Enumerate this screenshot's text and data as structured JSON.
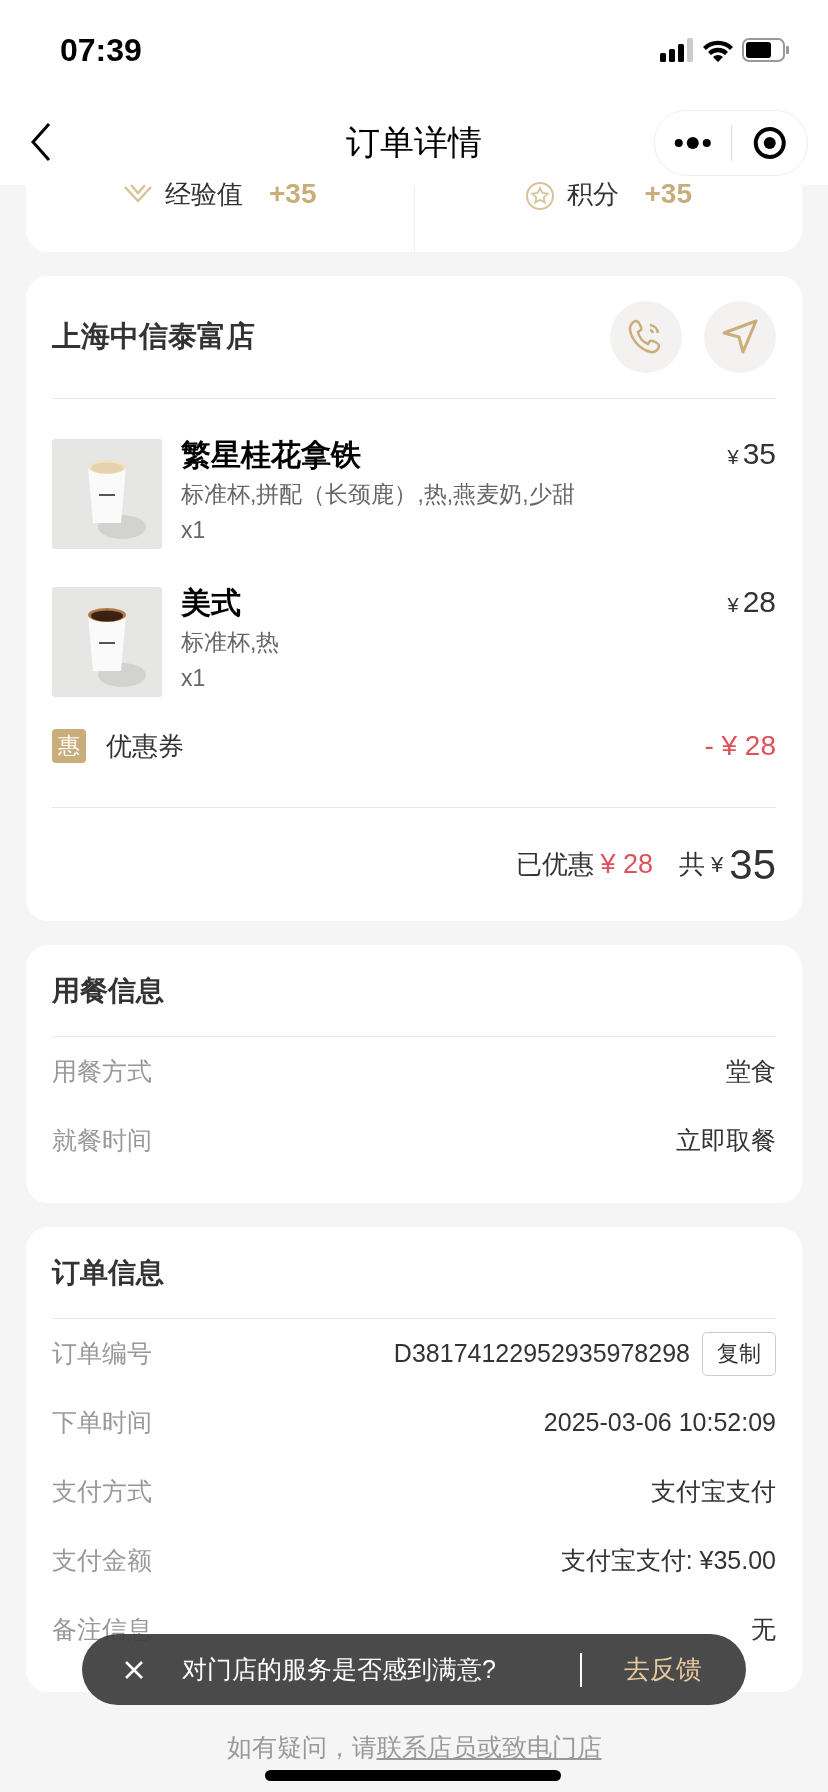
{
  "status_bar": {
    "time": "07:39"
  },
  "nav": {
    "title": "订单详情"
  },
  "rewards": [
    {
      "label": "经验值",
      "value": "+35",
      "kind": "experience"
    },
    {
      "label": "积分",
      "value": "+35",
      "kind": "points"
    }
  ],
  "store": {
    "name": "上海中信泰富店",
    "items": [
      {
        "name": "繁星桂花拿铁",
        "specs": "标准杯,拼配（长颈鹿）,热,燕麦奶,少甜",
        "quantity": "x1",
        "currency": "¥",
        "price": "35",
        "kind": "latte"
      },
      {
        "name": "美式",
        "specs": "标准杯,热",
        "quantity": "x1",
        "currency": "¥",
        "price": "28",
        "kind": "americano"
      }
    ],
    "coupon": {
      "badge": "惠",
      "label": "优惠券",
      "amount": "- ¥ 28"
    },
    "summary": {
      "discount_label": "已优惠",
      "discount": "¥ 28",
      "total_label": "共",
      "total_currency": "¥",
      "total": "35"
    }
  },
  "dining_info": {
    "title": "用餐信息",
    "rows": [
      {
        "label": "用餐方式",
        "value": "堂食"
      },
      {
        "label": "就餐时间",
        "value": "立即取餐"
      }
    ]
  },
  "order_info": {
    "title": "订单信息",
    "rows": [
      {
        "label": "订单编号",
        "value": "D38174122952935978298",
        "action": "复制"
      },
      {
        "label": "下单时间",
        "value": "2025-03-06 10:52:09"
      },
      {
        "label": "支付方式",
        "value": "支付宝支付"
      },
      {
        "label": "支付金额",
        "value": "支付宝支付: ¥35.00"
      },
      {
        "label": "备注信息",
        "value": "无"
      }
    ]
  },
  "toast": {
    "message": "对门店的服务是否感到满意?",
    "action": "去反馈"
  },
  "footer": {
    "text": "如有疑问，请",
    "link": "联系店员或致电门店"
  }
}
